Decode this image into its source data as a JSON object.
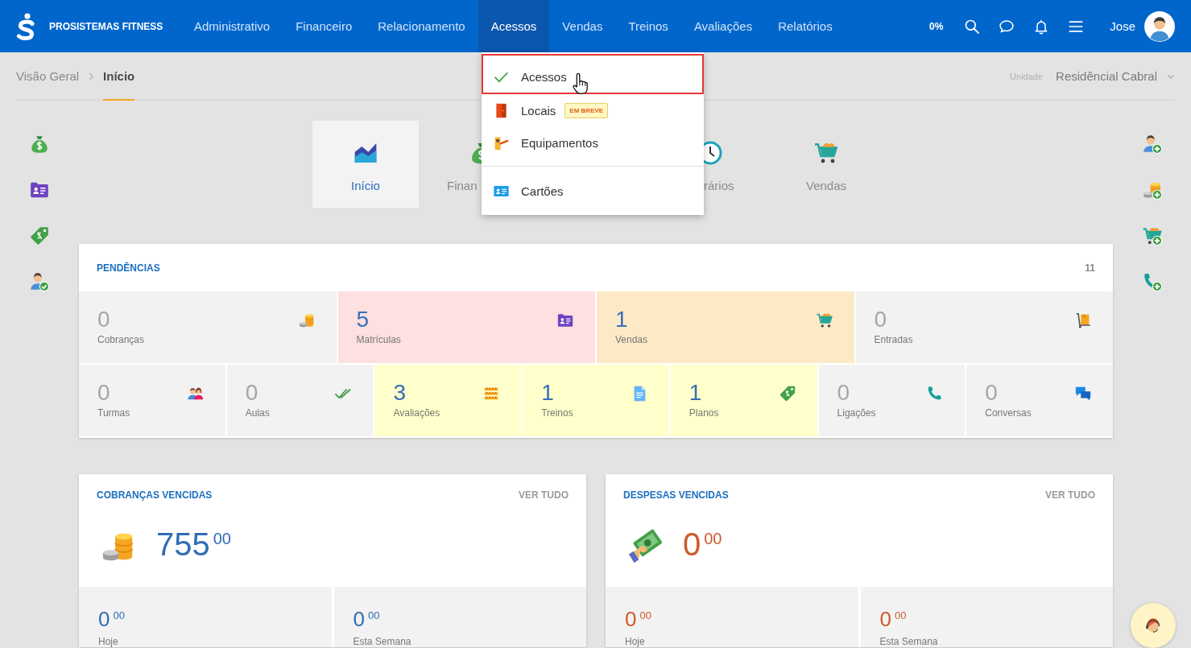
{
  "header": {
    "brand": "PROSISTEMAS FITNESS",
    "nav": [
      {
        "label": "Administrativo",
        "selected": false
      },
      {
        "label": "Financeiro",
        "selected": false
      },
      {
        "label": "Relacionamento",
        "selected": false
      },
      {
        "label": "Acessos",
        "selected": true
      },
      {
        "label": "Vendas",
        "selected": false
      },
      {
        "label": "Treinos",
        "selected": false
      },
      {
        "label": "Avaliações",
        "selected": false
      },
      {
        "label": "Relatórios",
        "selected": false
      }
    ],
    "progress": "0%",
    "user": "Jose"
  },
  "acessos_menu": {
    "items": [
      {
        "label": "Acessos",
        "highlighted": true,
        "separated": false
      },
      {
        "label": "Locais",
        "badge": "EM BREVE",
        "highlighted": false,
        "separated": false
      },
      {
        "label": "Equipamentos",
        "highlighted": false,
        "separated": false
      },
      {
        "label": "Cartões",
        "highlighted": false,
        "separated": true
      }
    ]
  },
  "breadcrumb": [
    {
      "label": "Visão Geral",
      "current": false
    },
    {
      "label": "Início",
      "current": true
    }
  ],
  "unit": {
    "label": "Unidade",
    "value": "Residêncial Cabral"
  },
  "tiles": [
    {
      "label": "Início",
      "selected": true,
      "kind": "whole"
    },
    {
      "label": "Finan",
      "selected": false,
      "kind": "cut_right"
    },
    {
      "label": "rários",
      "selected": false,
      "kind": "cut_left"
    },
    {
      "label": "Vendas",
      "selected": false,
      "kind": "whole"
    }
  ],
  "pendencias": {
    "title": "PENDÊNCIAS",
    "count": "11",
    "rows": [
      [
        {
          "value": "0",
          "label": "Cobranças",
          "color": "#f2f2f2",
          "active": false
        },
        {
          "value": "5",
          "label": "Matrículas",
          "color": "#fde0df",
          "active": true
        },
        {
          "value": "1",
          "label": "Vendas",
          "color": "#fde9c6",
          "active": true
        },
        {
          "value": "0",
          "label": "Entradas",
          "color": "#f2f2f2",
          "active": false
        }
      ],
      [
        {
          "value": "0",
          "label": "Turmas",
          "color": "#f2f2f2",
          "active": false
        },
        {
          "value": "0",
          "label": "Aulas",
          "color": "#f2f2f2",
          "active": false
        },
        {
          "value": "3",
          "label": "Avaliações",
          "color": "#ffffcc",
          "active": true
        },
        {
          "value": "1",
          "label": "Treinos",
          "color": "#ffffcc",
          "active": true
        },
        {
          "value": "1",
          "label": "Planos",
          "color": "#ffffcc",
          "active": true
        },
        {
          "value": "0",
          "label": "Ligações",
          "color": "#f2f2f2",
          "active": false
        },
        {
          "value": "0",
          "label": "Conversas",
          "color": "#f2f2f2",
          "active": false
        }
      ]
    ]
  },
  "cards": [
    {
      "title": "COBRANÇAS VENCIDAS",
      "link": "VER TUDO",
      "color": "#2f6db5",
      "total": "755$^{00}$",
      "periods": [
        {
          "value": "0$^{00}$",
          "label": "Hoje"
        },
        {
          "value": "0$^{00}$",
          "label": "Esta Semana"
        }
      ]
    },
    {
      "title": "DESPESAS VENCIDAS",
      "link": "VER TUDO",
      "color": "#cf5a2c",
      "total": "0$^{00}$",
      "periods": [
        {
          "value": "0$^{00}$",
          "label": "Hoje"
        },
        {
          "value": "0$^{00}$",
          "label": "Esta Semana"
        }
      ]
    }
  ]
}
